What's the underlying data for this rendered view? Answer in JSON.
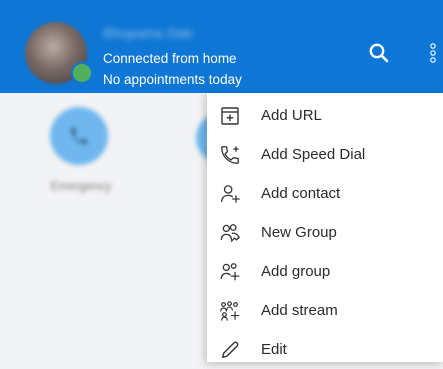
{
  "header": {
    "user_name": "Bhupama Dab",
    "status_line_1": "Connected from home",
    "status_line_2": "No appointments today",
    "background_color": "#0e76d4"
  },
  "background": {
    "tile_label": "Emergency"
  },
  "menu": {
    "items": [
      {
        "label": "Add URL",
        "icon": "add-url-icon"
      },
      {
        "label": "Add Speed Dial",
        "icon": "speed-dial-icon"
      },
      {
        "label": "Add contact",
        "icon": "add-contact-icon"
      },
      {
        "label": "New Group",
        "icon": "new-group-icon"
      },
      {
        "label": "Add group",
        "icon": "add-group-icon"
      },
      {
        "label": "Add stream",
        "icon": "add-stream-icon"
      },
      {
        "label": "Edit",
        "icon": "edit-pencil-icon"
      }
    ]
  },
  "colors": {
    "accent": "#0e76d4",
    "presence_online": "#52b05a",
    "tile": "#6fb7ee"
  }
}
